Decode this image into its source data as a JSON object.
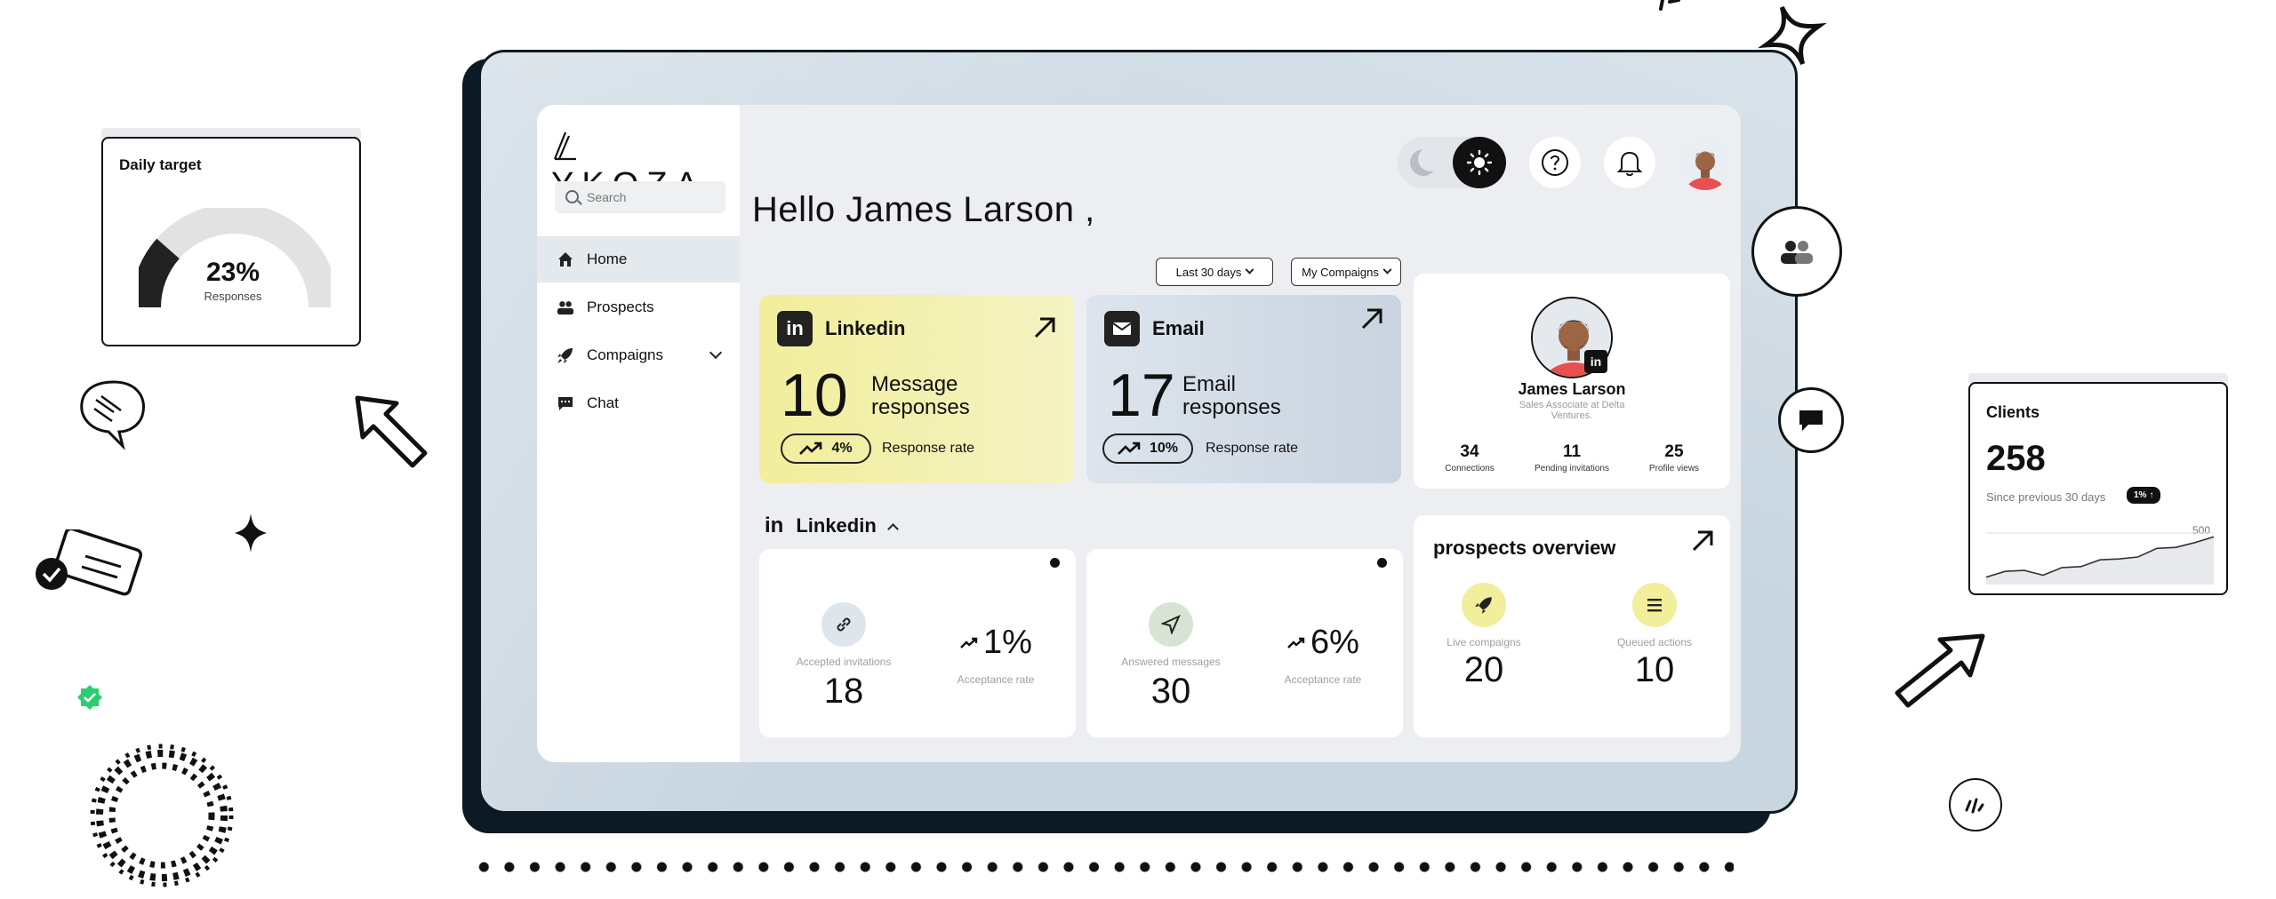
{
  "brand": {
    "logo_text": "YKOZA"
  },
  "search": {
    "placeholder": "Search"
  },
  "sidebar": {
    "items": [
      {
        "label": "Home",
        "icon": "home-icon",
        "active": true
      },
      {
        "label": "Prospects",
        "icon": "people-icon"
      },
      {
        "label": "Compaigns",
        "icon": "rocket-icon",
        "has_submenu": true
      },
      {
        "label": "Chat",
        "icon": "chat-icon"
      }
    ]
  },
  "greeting": "Hello James Larson ,",
  "filters": {
    "period": "Last 30 days",
    "campaigns": "My Compaigns"
  },
  "cards": {
    "linkedin": {
      "title": "Linkedin",
      "icon_text": "in",
      "value": "10",
      "label": "Message responses",
      "rate": "4%",
      "rate_label": "Response rate",
      "color": "#f1ee9c"
    },
    "email": {
      "title": "Email",
      "value": "17",
      "label": "Email responses",
      "rate": "10%",
      "rate_label": "Response rate",
      "color": "#d3dce6"
    }
  },
  "profile": {
    "name": "James Larson",
    "role": "Sales Associate at Delta Ventures.",
    "badge": "in",
    "stats": [
      {
        "value": "34",
        "label": "Connections"
      },
      {
        "value": "11",
        "label": "Pending invitations"
      },
      {
        "value": "25",
        "label": "Profile views"
      }
    ]
  },
  "linkedin_section": {
    "icon_text": "in",
    "title": "Linkedin",
    "cards": [
      {
        "label": "Accepted invitations",
        "value": "18",
        "pct": "1%",
        "pct_label": "Acceptance rate"
      },
      {
        "label": "Answered messages",
        "value": "30",
        "pct": "6%",
        "pct_label": "Acceptance rate"
      }
    ]
  },
  "overview": {
    "title": "prospects overview",
    "items": [
      {
        "label": "Live compaigns",
        "value": "20"
      },
      {
        "label": "Queued actions",
        "value": "10"
      }
    ]
  },
  "daily_target": {
    "title": "Daily target",
    "value": "23%",
    "label": "Responses",
    "fraction": 0.23
  },
  "clients": {
    "title": "Clients",
    "value": "258",
    "since": "Since previous 30 days",
    "badge": "1%",
    "axis_max": "500",
    "trend": [
      0.08,
      0.2,
      0.22,
      0.12,
      0.28,
      0.3,
      0.44,
      0.46,
      0.5,
      0.68,
      0.7,
      0.8,
      0.92
    ]
  },
  "colors": {
    "accent_yellow": "#f1ee9c",
    "dark": "#111111",
    "frame": "#c9d6e0",
    "green_check": "#2ecc71"
  }
}
